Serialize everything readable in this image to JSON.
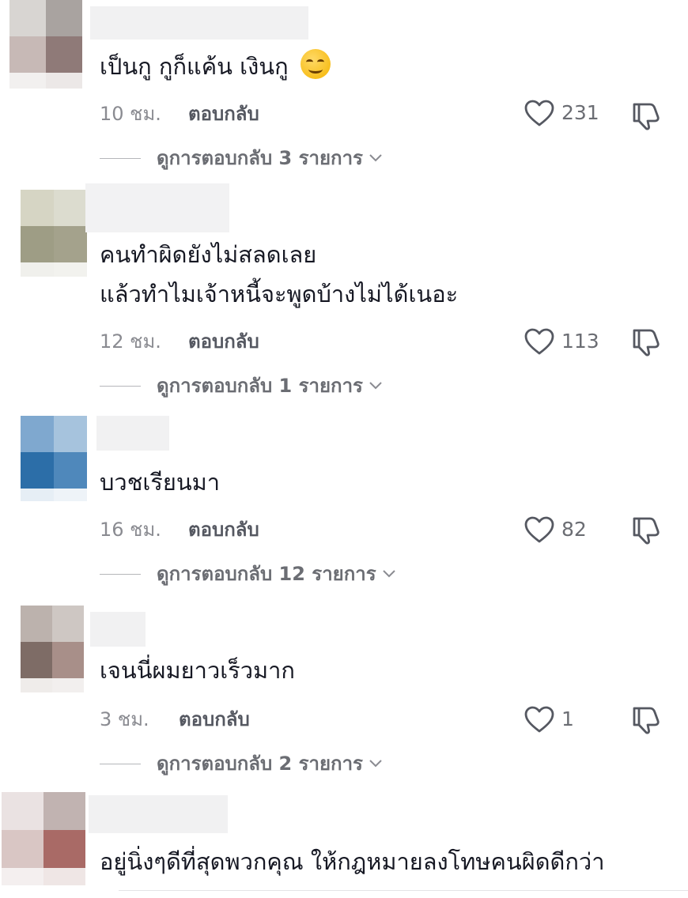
{
  "comments": [
    {
      "text_lines": [
        "เป็นกู กูก็แค้น เงินกู"
      ],
      "emoji": "smirk-emoji",
      "time": "10 ชม.",
      "reply_label": "ตอบกลับ",
      "likes": "231",
      "view_replies": "ดูการตอบกลับ 3 รายการ"
    },
    {
      "text_lines": [
        "คนทำผิดยังไม่สลดเลย",
        "แล้วทำไมเจ้าหนี้จะพูดบ้างไม่ได้เนอะ"
      ],
      "time": "12 ชม.",
      "reply_label": "ตอบกลับ",
      "likes": "113",
      "view_replies": "ดูการตอบกลับ 1 รายการ"
    },
    {
      "text_lines": [
        "บวชเรียนมา"
      ],
      "time": "16 ชม.",
      "reply_label": "ตอบกลับ",
      "likes": "82",
      "view_replies": "ดูการตอบกลับ 12 รายการ"
    },
    {
      "text_lines": [
        "เจนนี่ผมยาวเร็วมาก"
      ],
      "time": "3 ชม.",
      "reply_label": "ตอบกลับ",
      "likes": "1",
      "view_replies": "ดูการตอบกลับ 2 รายการ"
    },
    {
      "text_lines": [
        "อยู่นิ่งๆดีที่สุดพวกคุณ ให้กฎหมายลงโทษคนผิดดีกว่า"
      ]
    }
  ],
  "icons": {
    "like": "heart-outline-icon",
    "dislike": "thumbs-down-outline-icon",
    "expand": "chevron-down-icon"
  },
  "colors": {
    "text": "#161823",
    "meta": "#8a8b91",
    "icon": "#555861"
  }
}
